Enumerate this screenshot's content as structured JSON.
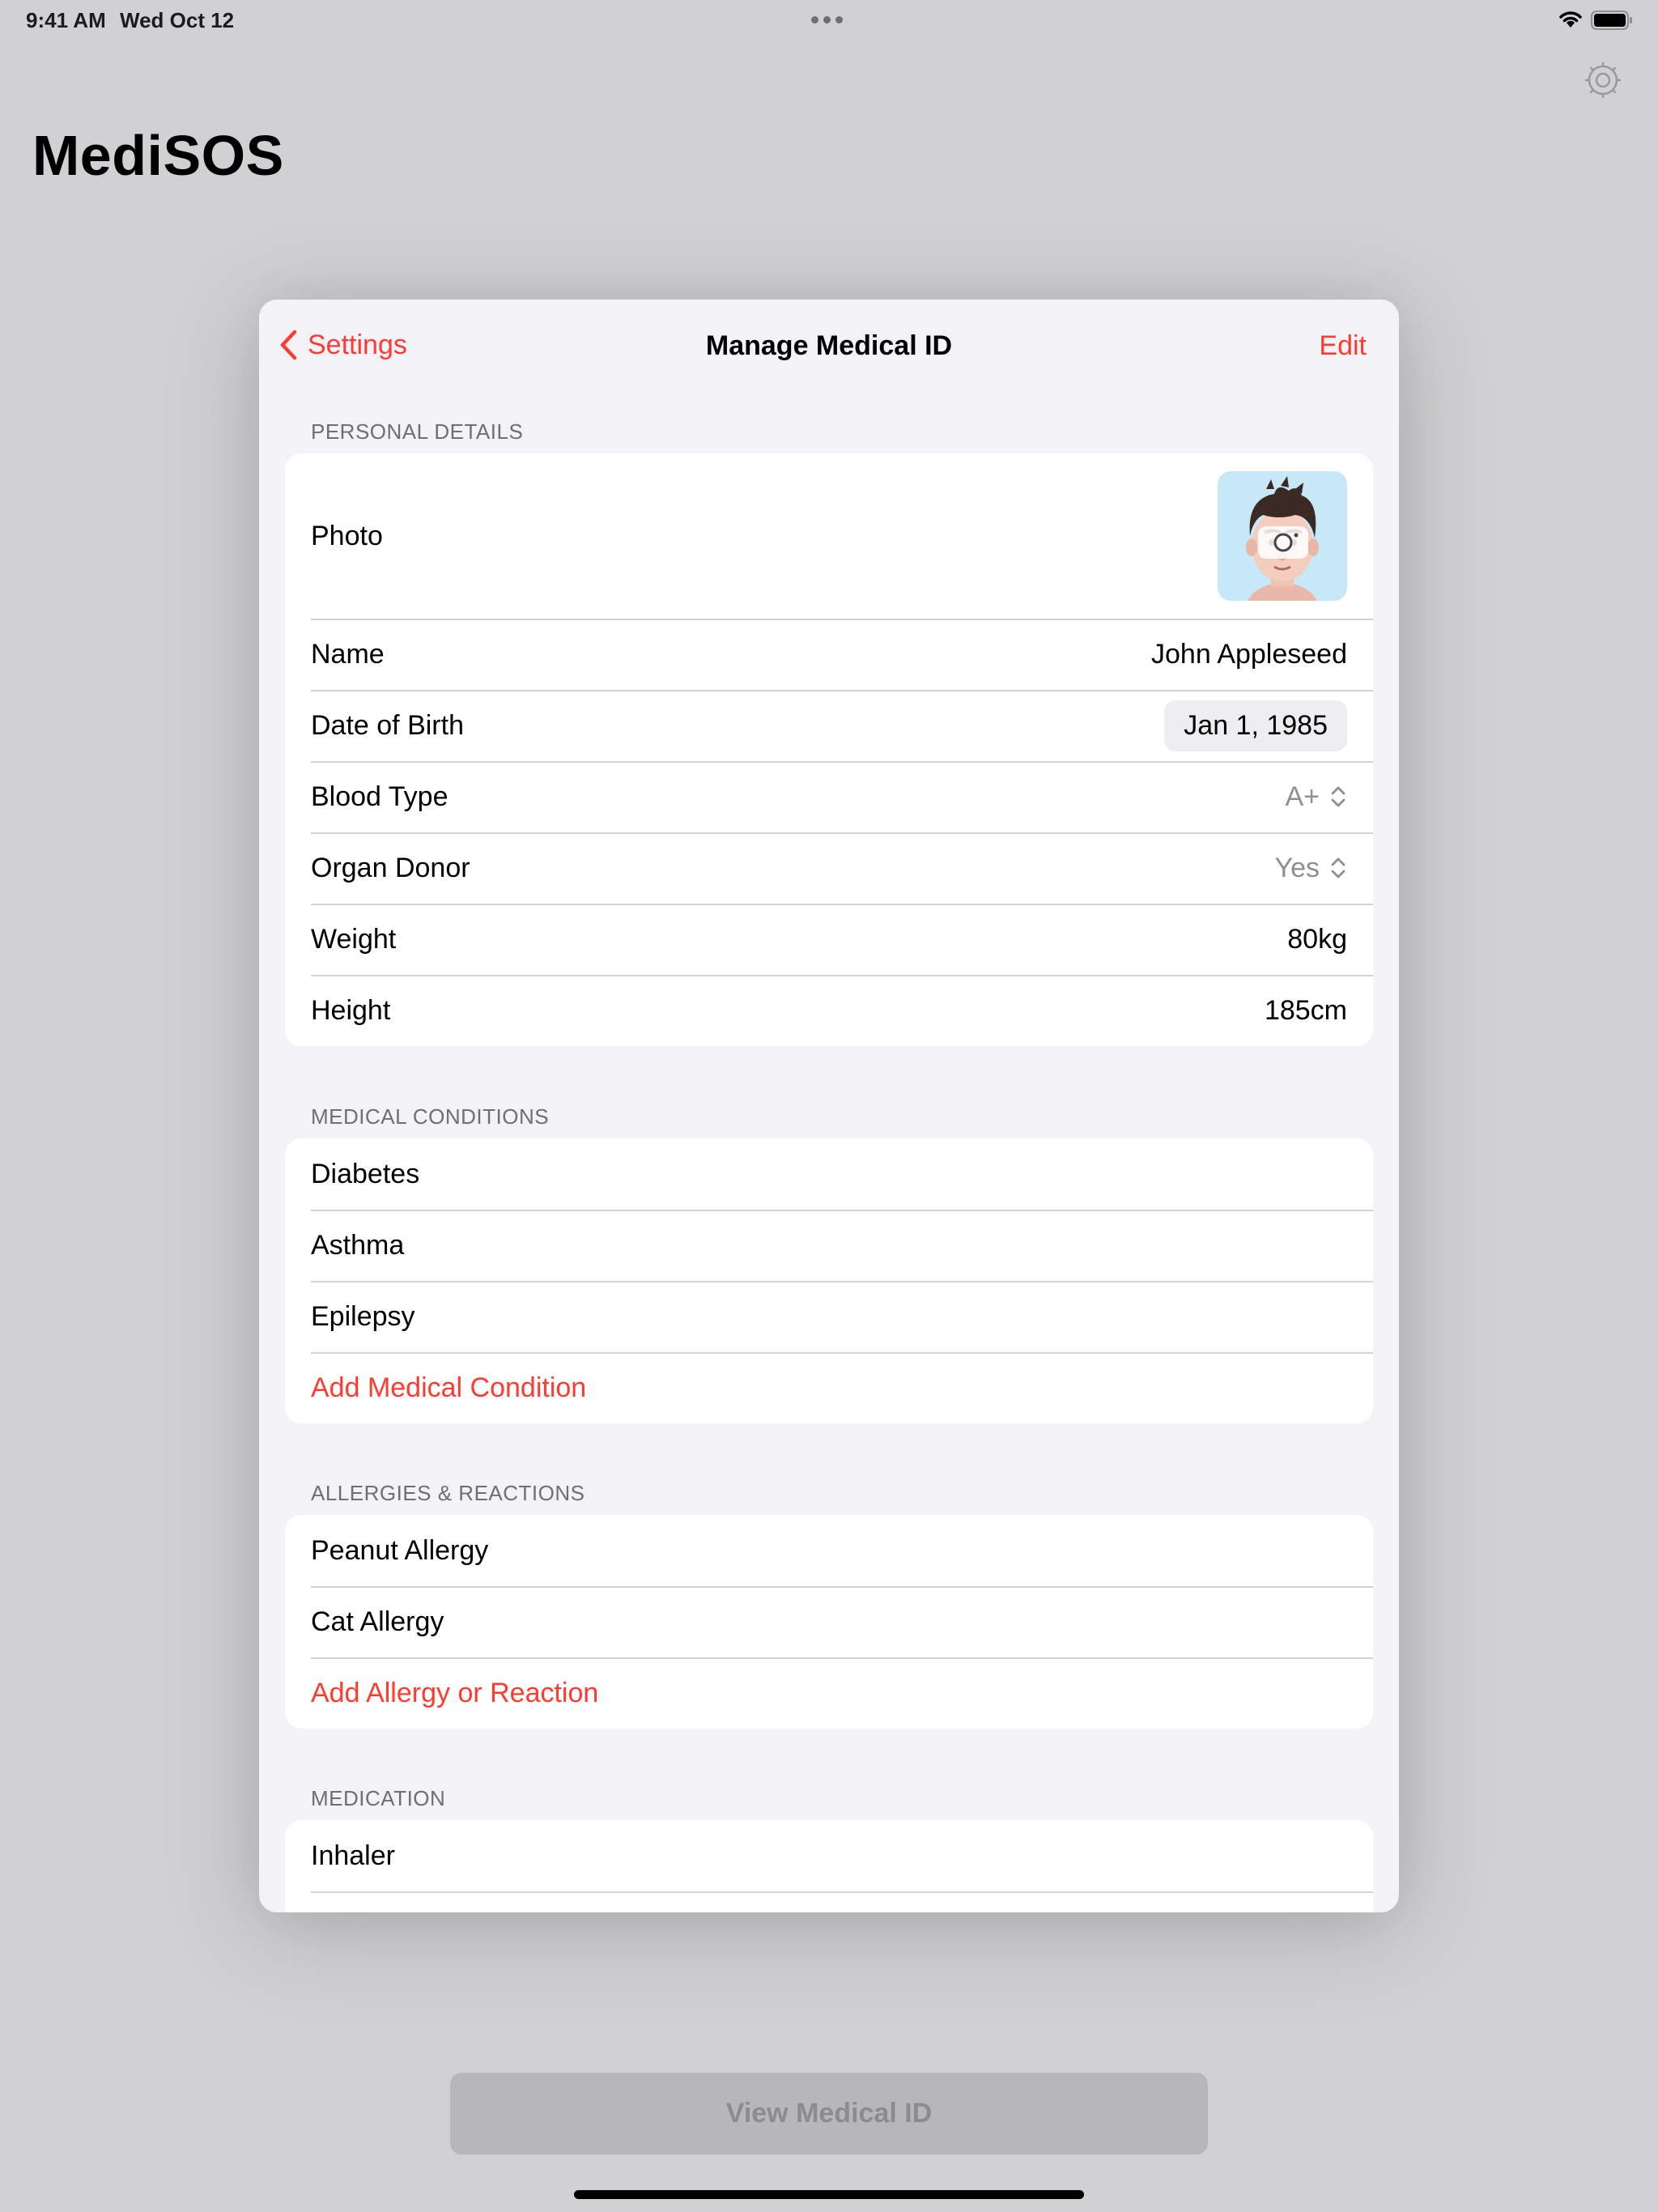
{
  "status_bar": {
    "time": "9:41 AM",
    "date": "Wed Oct 12"
  },
  "app": {
    "title": "MediSOS",
    "view_button_label": "View Medical ID"
  },
  "sheet": {
    "back_label": "Settings",
    "title": "Manage Medical ID",
    "edit_label": "Edit",
    "personal": {
      "header": "PERSONAL DETAILS",
      "photo_label": "Photo",
      "name_label": "Name",
      "name_value": "John Appleseed",
      "dob_label": "Date of Birth",
      "dob_value": "Jan 1, 1985",
      "blood_label": "Blood Type",
      "blood_value": "A+",
      "donor_label": "Organ Donor",
      "donor_value": "Yes",
      "weight_label": "Weight",
      "weight_value": "80kg",
      "height_label": "Height",
      "height_value": "185cm"
    },
    "conditions": {
      "header": "MEDICAL CONDITIONS",
      "items": [
        "Diabetes",
        "Asthma",
        "Epilepsy"
      ],
      "add_label": "Add Medical Condition"
    },
    "allergies": {
      "header": "ALLERGIES & REACTIONS",
      "items": [
        "Peanut Allergy",
        "Cat Allergy"
      ],
      "add_label": "Add Allergy or Reaction"
    },
    "medication": {
      "header": "MEDICATION",
      "items": [
        "Inhaler"
      ]
    }
  },
  "colors": {
    "accent": "#ff3b30",
    "sheet_bg": "#f2f2f7",
    "backdrop": "#d1d1d3",
    "secondary_text": "#8e8e93"
  },
  "icons": [
    "wifi-icon",
    "battery-icon",
    "settings-gear-icon",
    "back-chevron-icon",
    "up-down-chevron-icon",
    "camera-icon",
    "memoji-avatar"
  ]
}
